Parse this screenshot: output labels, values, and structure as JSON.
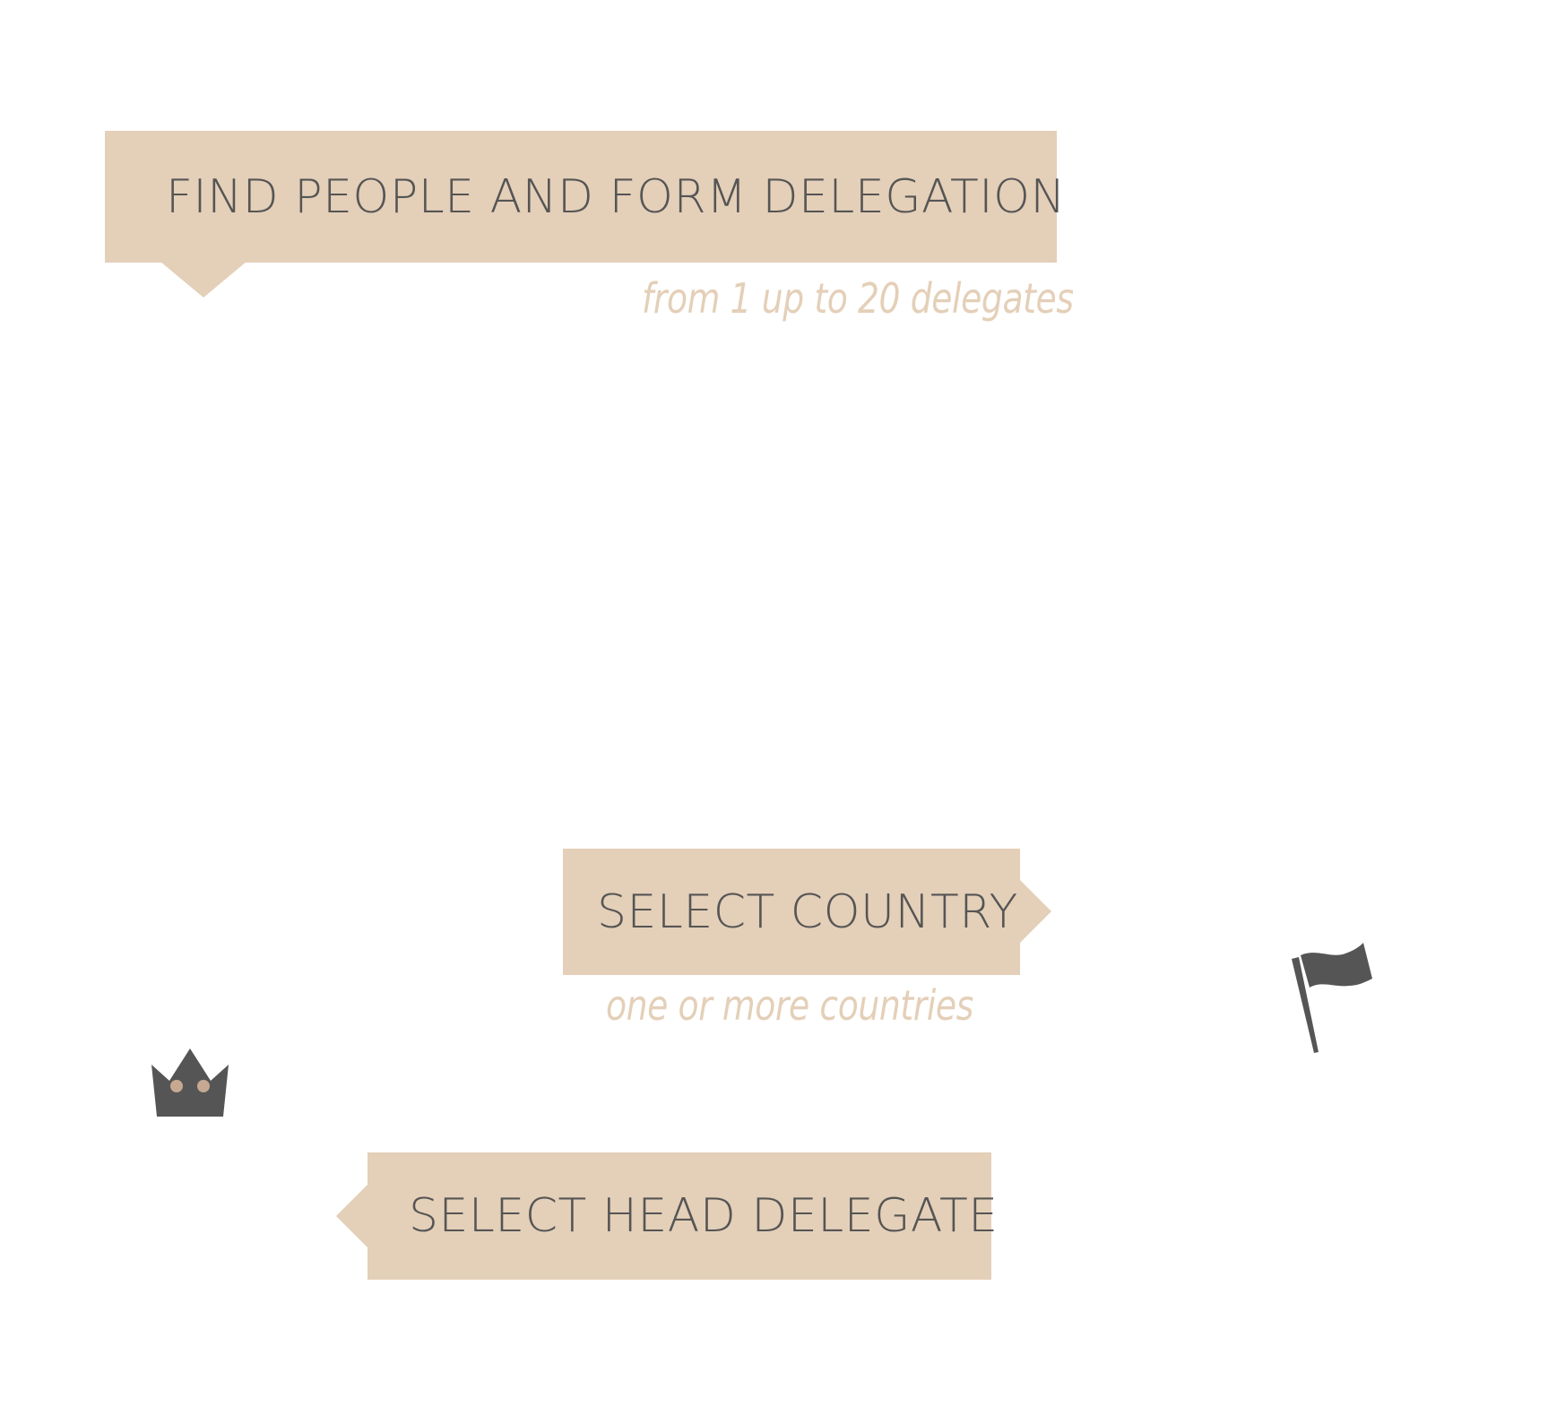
{
  "steps": [
    {
      "label": "FIND PEOPLE AND FORM DELEGATION",
      "note": "from 1 up to 20 delegates"
    },
    {
      "label": "SELECT COUNTRY",
      "note": "one or more countries",
      "icon": "flag-icon"
    },
    {
      "label": "SELECT HEAD DELEGATE",
      "icon": "crown-icon"
    }
  ],
  "colors": {
    "ribbon": "#e4cfb8",
    "text": "#555555",
    "icon": "#555555",
    "note": "#e4cfb8"
  }
}
